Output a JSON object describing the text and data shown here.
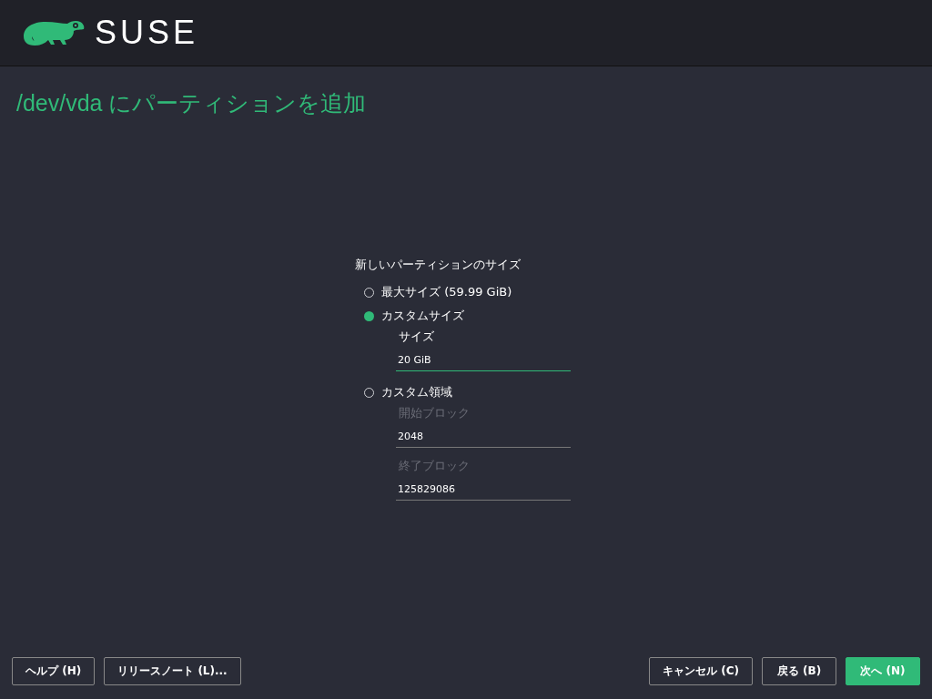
{
  "header": {
    "logo_text": "SUSE"
  },
  "title": "/dev/vda にパーティションを追加",
  "size_group": {
    "label": "新しいパーティションのサイズ",
    "options": [
      {
        "label": "最大サイズ (59.99 GiB)",
        "selected": false
      },
      {
        "label": "カスタムサイズ",
        "selected": true,
        "fields": [
          {
            "label": "サイズ",
            "value": "20 GiB",
            "disabled": false,
            "focused": true
          }
        ]
      },
      {
        "label": "カスタム領域",
        "selected": false,
        "fields": [
          {
            "label": "開始ブロック",
            "value": "2048",
            "disabled": true,
            "focused": false
          },
          {
            "label": "終了ブロック",
            "value": "125829086",
            "disabled": true,
            "focused": false
          }
        ]
      }
    ]
  },
  "buttons_left": [
    {
      "label": "ヘルプ (H)",
      "primary": false
    },
    {
      "label": "リリースノート (L)...",
      "primary": false
    }
  ],
  "buttons_right": [
    {
      "label": "キャンセル (C)",
      "primary": false
    },
    {
      "label": "戻る (B)",
      "primary": false
    },
    {
      "label": "次へ (N)",
      "primary": true
    }
  ]
}
